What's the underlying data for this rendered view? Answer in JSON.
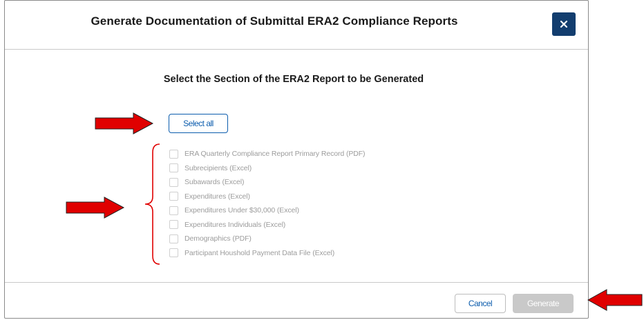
{
  "dialog": {
    "title": "Generate Documentation of Submittal ERA2 Compliance Reports",
    "close_label": "×"
  },
  "body": {
    "subtitle": "Select the Section of the ERA2 Report to be Generated",
    "select_all_label": "Select all",
    "options": [
      {
        "label": "ERA Quarterly Compliance Report Primary Record (PDF)",
        "checked": false
      },
      {
        "label": "Subrecipients (Excel)",
        "checked": false
      },
      {
        "label": "Subawards (Excel)",
        "checked": false
      },
      {
        "label": "Expenditures (Excel)",
        "checked": false
      },
      {
        "label": "Expenditures Under $30,000 (Excel)",
        "checked": false
      },
      {
        "label": "Expenditures Individuals (Excel)",
        "checked": false
      },
      {
        "label": "Demographics (PDF)",
        "checked": false
      },
      {
        "label": "Participant Houshold Payment Data File (Excel)",
        "checked": false
      }
    ]
  },
  "footer": {
    "cancel_label": "Cancel",
    "generate_label": "Generate",
    "generate_enabled": false
  },
  "annotations": {
    "color": "#e00000",
    "arrows": [
      "arrow-right-icon",
      "arrow-right-icon",
      "arrow-left-icon"
    ],
    "bracket": "curly-bracket-icon"
  },
  "colors": {
    "close_button_bg": "#123d6e",
    "link_blue": "#0b5cad",
    "disabled_button_bg": "#c9c9c9"
  }
}
